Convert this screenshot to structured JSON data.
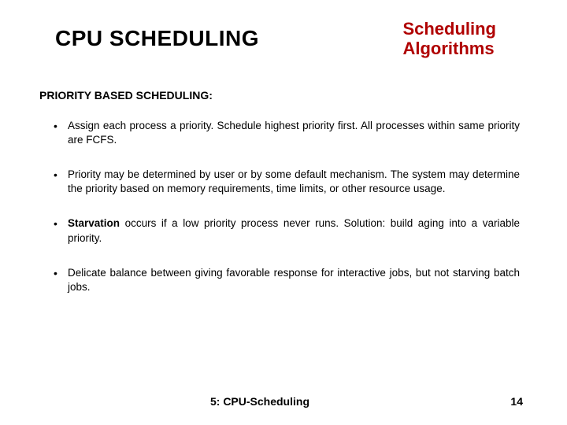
{
  "header": {
    "title": "CPU SCHEDULING",
    "subtitle_line1": "Scheduling",
    "subtitle_line2": "Algorithms"
  },
  "section_heading": "PRIORITY BASED SCHEDULING:",
  "bullets": [
    {
      "text": "Assign each process a priority. Schedule highest priority first. All processes within same priority are FCFS."
    },
    {
      "text": "Priority may be determined by user or by some default mechanism.  The system may determine the priority based on memory requirements, time limits, or other resource usage."
    },
    {
      "bold_prefix": "Starvation",
      "text": " occurs if a low priority process never runs. Solution: build aging into a variable priority."
    },
    {
      "text": "Delicate balance between giving favorable response for interactive jobs, but not starving batch jobs."
    }
  ],
  "footer": {
    "center": "5: CPU-Scheduling",
    "right": "14"
  }
}
